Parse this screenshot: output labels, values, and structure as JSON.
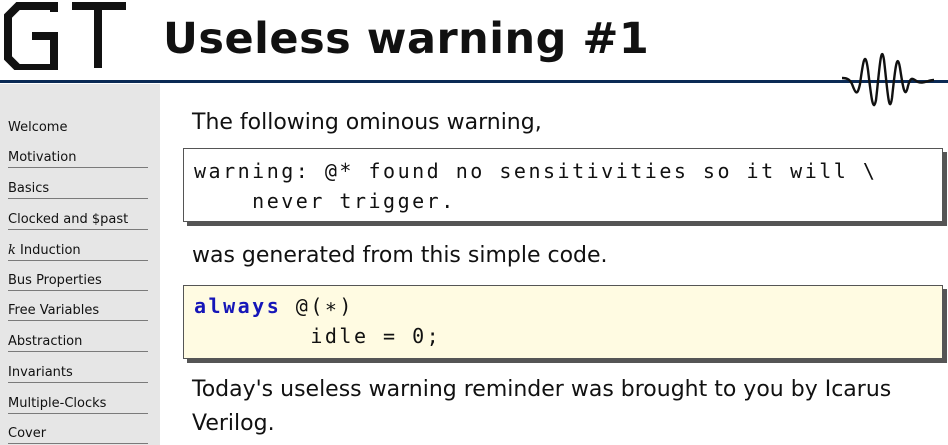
{
  "header": {
    "title": "Useless warning #1"
  },
  "sidebar": {
    "items": [
      {
        "label": "Welcome"
      },
      {
        "label": "Motivation"
      },
      {
        "label": "Basics"
      },
      {
        "label": "Clocked and $past"
      },
      {
        "label": "k Induction"
      },
      {
        "label": "Bus Properties"
      },
      {
        "label": "Free Variables"
      },
      {
        "label": "Abstraction"
      },
      {
        "label": "Invariants"
      },
      {
        "label": "Multiple-Clocks"
      },
      {
        "label": "Cover"
      }
    ]
  },
  "main": {
    "intro": "The following ominous warning,",
    "warning_line1": "warning: @* found no sensitivities so it will \\",
    "warning_line2": "    never trigger.",
    "middle": "was generated from this simple code.",
    "code_keyword": "always",
    "code_line1_rest": " @(∗)",
    "code_line2": "        idle = 0;",
    "closing_line1": "Today's useless warning reminder was brought to you by Icarus",
    "closing_line2": "Verilog."
  }
}
